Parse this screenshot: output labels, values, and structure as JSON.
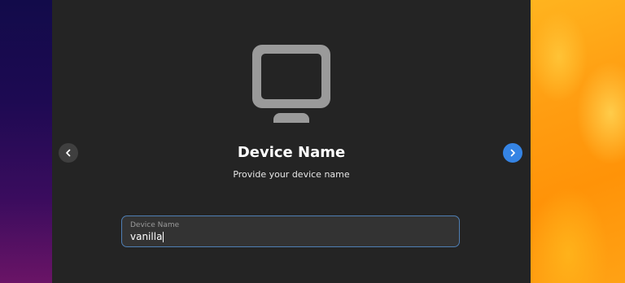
{
  "window": {
    "title": "Device Name",
    "subtitle": "Provide your device name"
  },
  "icons": {
    "main": "computer-monitor-icon",
    "prev": "chevron-left-icon",
    "next": "chevron-right-icon"
  },
  "form": {
    "device_name": {
      "label": "Device Name",
      "value": "vanilla"
    }
  },
  "colors": {
    "accent": "#3584e4",
    "window_bg": "#242424",
    "field_border": "#4f7fb4"
  }
}
